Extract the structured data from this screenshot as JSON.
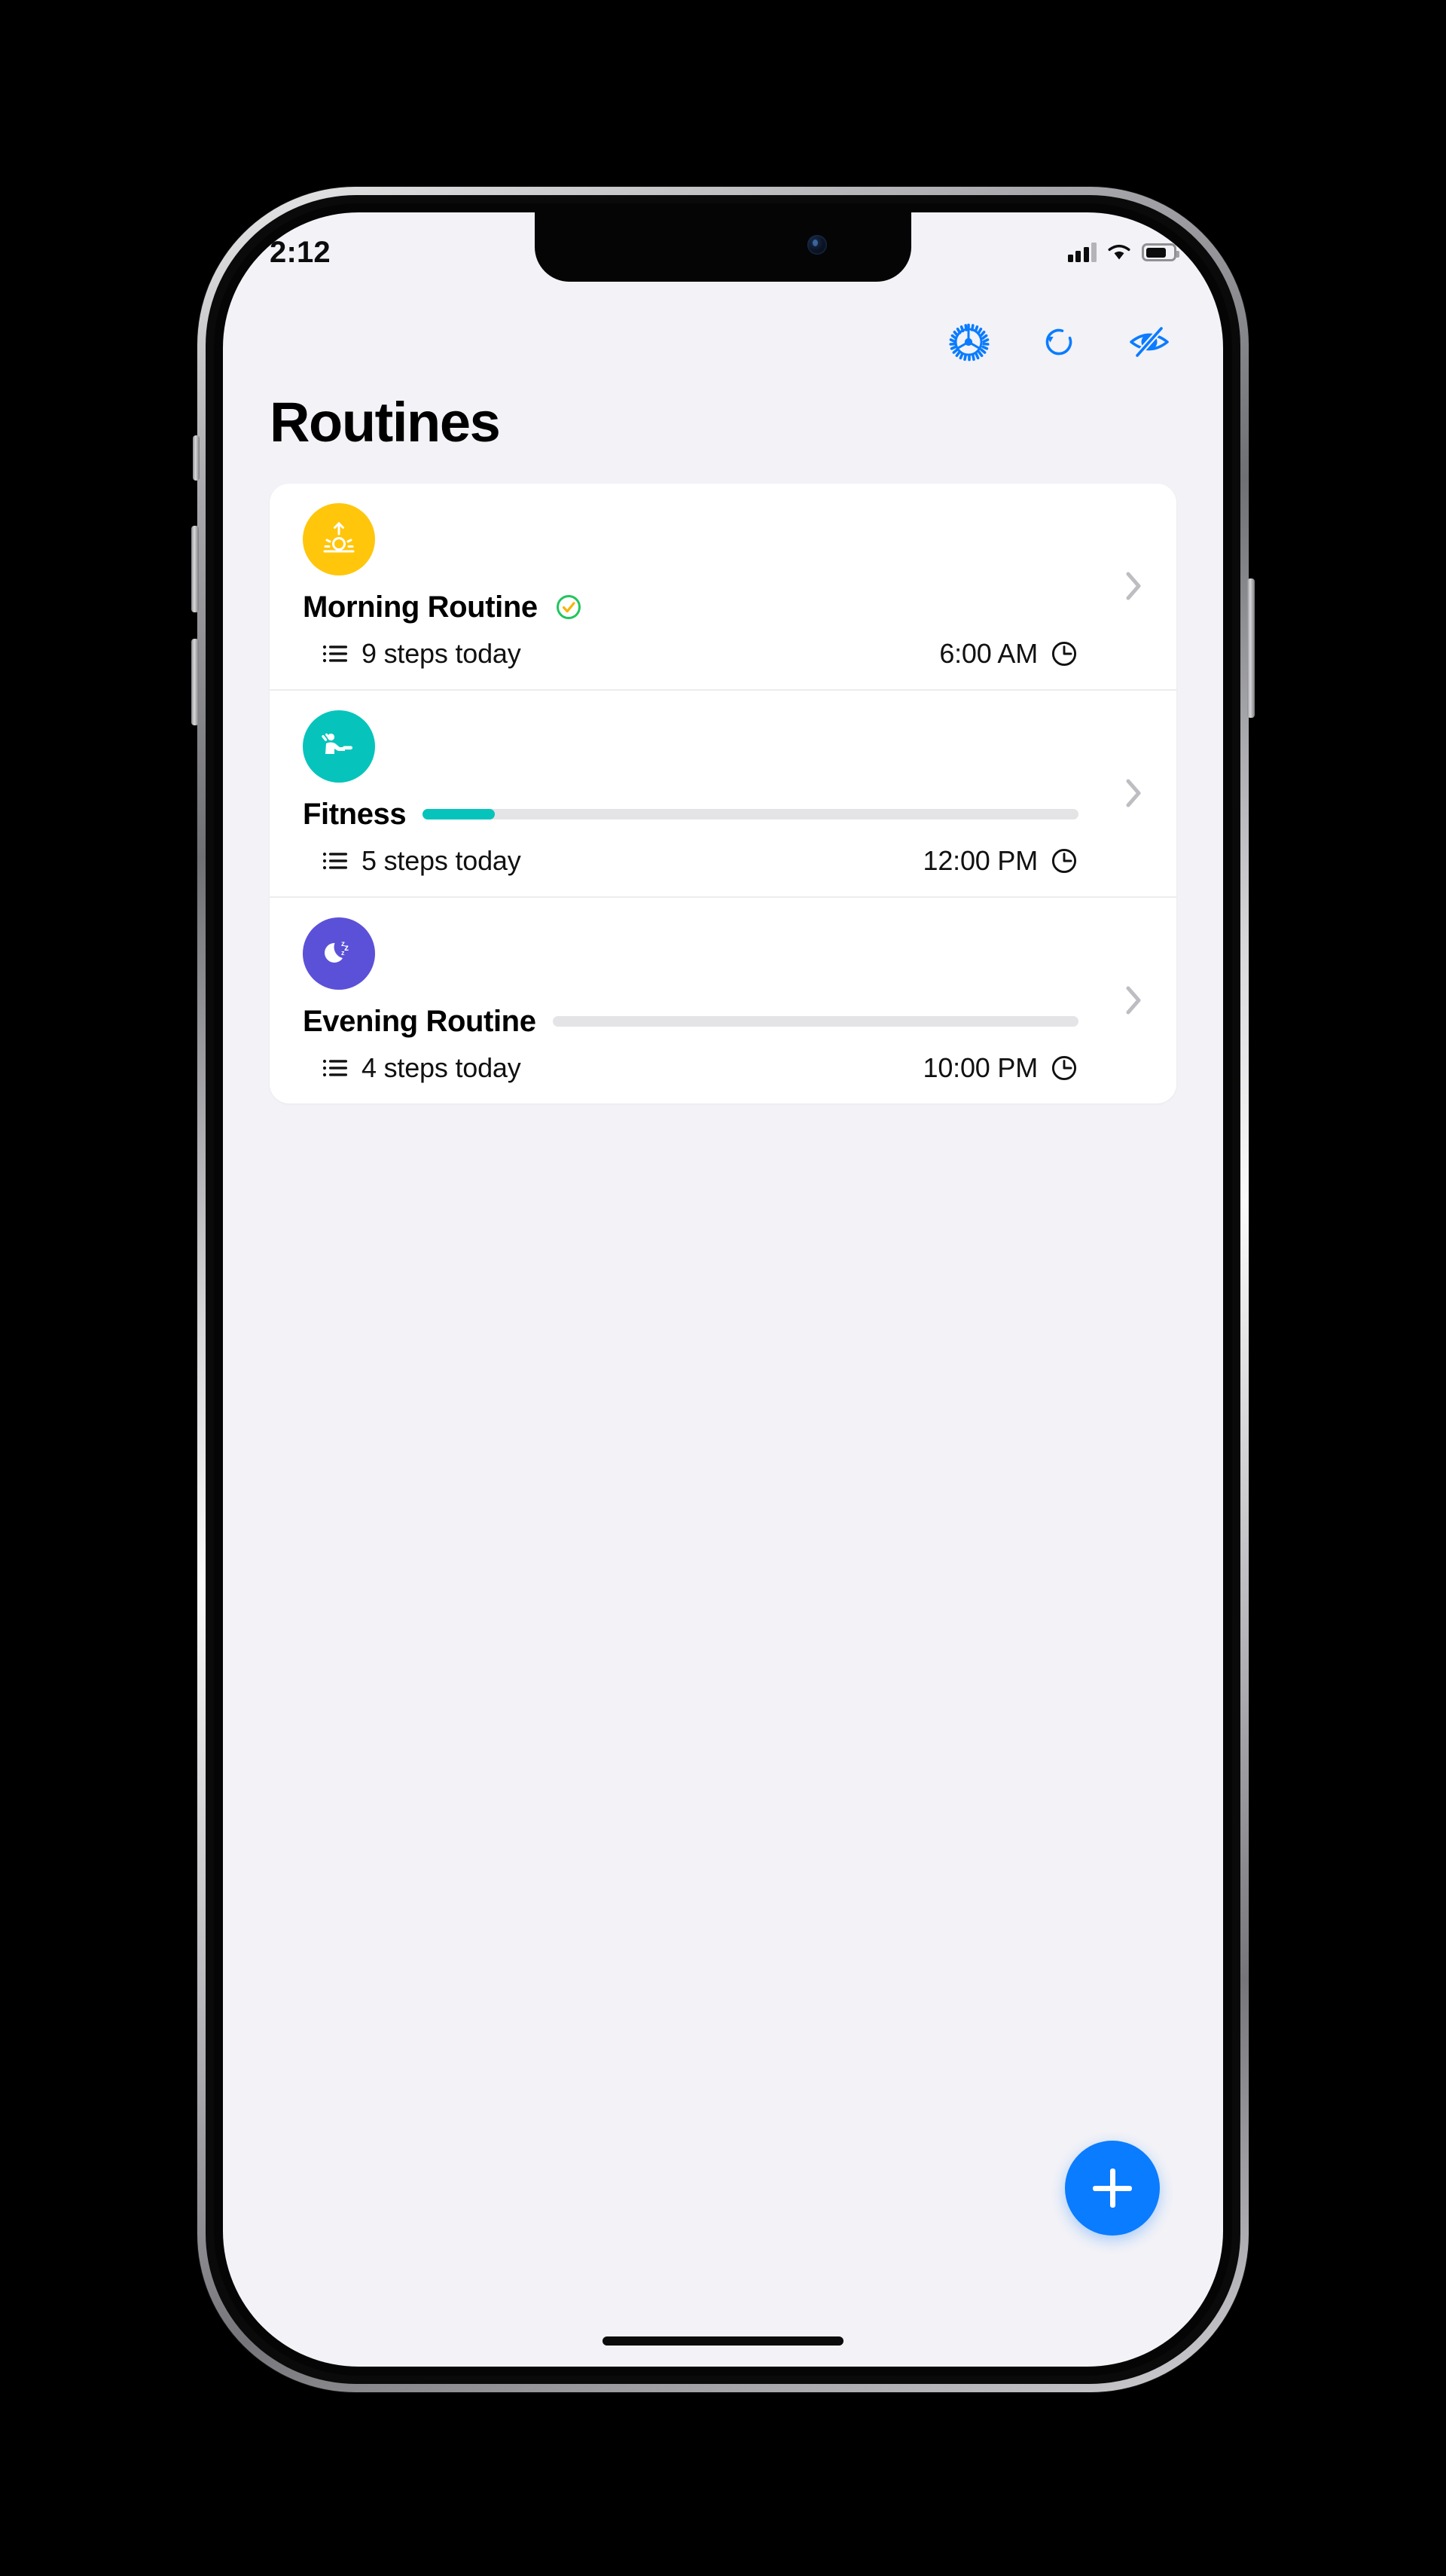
{
  "status_bar": {
    "time": "2:12",
    "icons": [
      "cellular-signal-icon",
      "wifi-icon",
      "battery-icon"
    ]
  },
  "toolbar": {
    "buttons": [
      {
        "name": "settings-button",
        "icon": "gear-icon",
        "color": "#0a7cff"
      },
      {
        "name": "reset-button",
        "icon": "reset-circular-arrow-icon",
        "color": "#0a7cff"
      },
      {
        "name": "hide-button",
        "icon": "eye-off-icon",
        "color": "#0a7cff"
      }
    ]
  },
  "page": {
    "title": "Routines"
  },
  "routines": [
    {
      "name": "Morning Routine",
      "avatar_icon": "sunrise-icon",
      "avatar_color": "#ffc60b",
      "completed": true,
      "completed_icon": "check-circle-icon",
      "completed_ring_color": "#22c55e",
      "completed_check_color": "#f5b50a",
      "steps_label": "9 steps today",
      "steps_count": 9,
      "time": "6:00 AM",
      "progress_percent": 0,
      "progress_color": "#ffc60b",
      "show_progress": false,
      "steps_icon": "list-icon",
      "time_icon": "clock-icon",
      "chevron_icon": "chevron-right-icon"
    },
    {
      "name": "Fitness",
      "avatar_icon": "weightlifter-icon",
      "avatar_color": "#06c4bb",
      "completed": false,
      "steps_label": "5 steps today",
      "steps_count": 5,
      "time": "12:00 PM",
      "progress_percent": 11,
      "progress_color": "#06c4bb",
      "show_progress": true,
      "steps_icon": "list-icon",
      "time_icon": "clock-icon",
      "chevron_icon": "chevron-right-icon"
    },
    {
      "name": "Evening Routine",
      "avatar_icon": "moon-zzz-icon",
      "avatar_color": "#5b51d8",
      "completed": false,
      "steps_label": "4 steps today",
      "steps_count": 4,
      "time": "10:00 PM",
      "progress_percent": 0,
      "progress_color": "#5b51d8",
      "show_progress": true,
      "steps_icon": "list-icon",
      "time_icon": "clock-icon",
      "chevron_icon": "chevron-right-icon"
    }
  ],
  "fab": {
    "name": "add-routine-button",
    "icon": "plus-icon",
    "color": "#0a7cff"
  },
  "colors": {
    "screen_background": "#f2f2f7",
    "card_background": "#ffffff",
    "accent": "#0a7cff",
    "track": "#e4e4e7",
    "chevron": "#b9b9bd"
  }
}
